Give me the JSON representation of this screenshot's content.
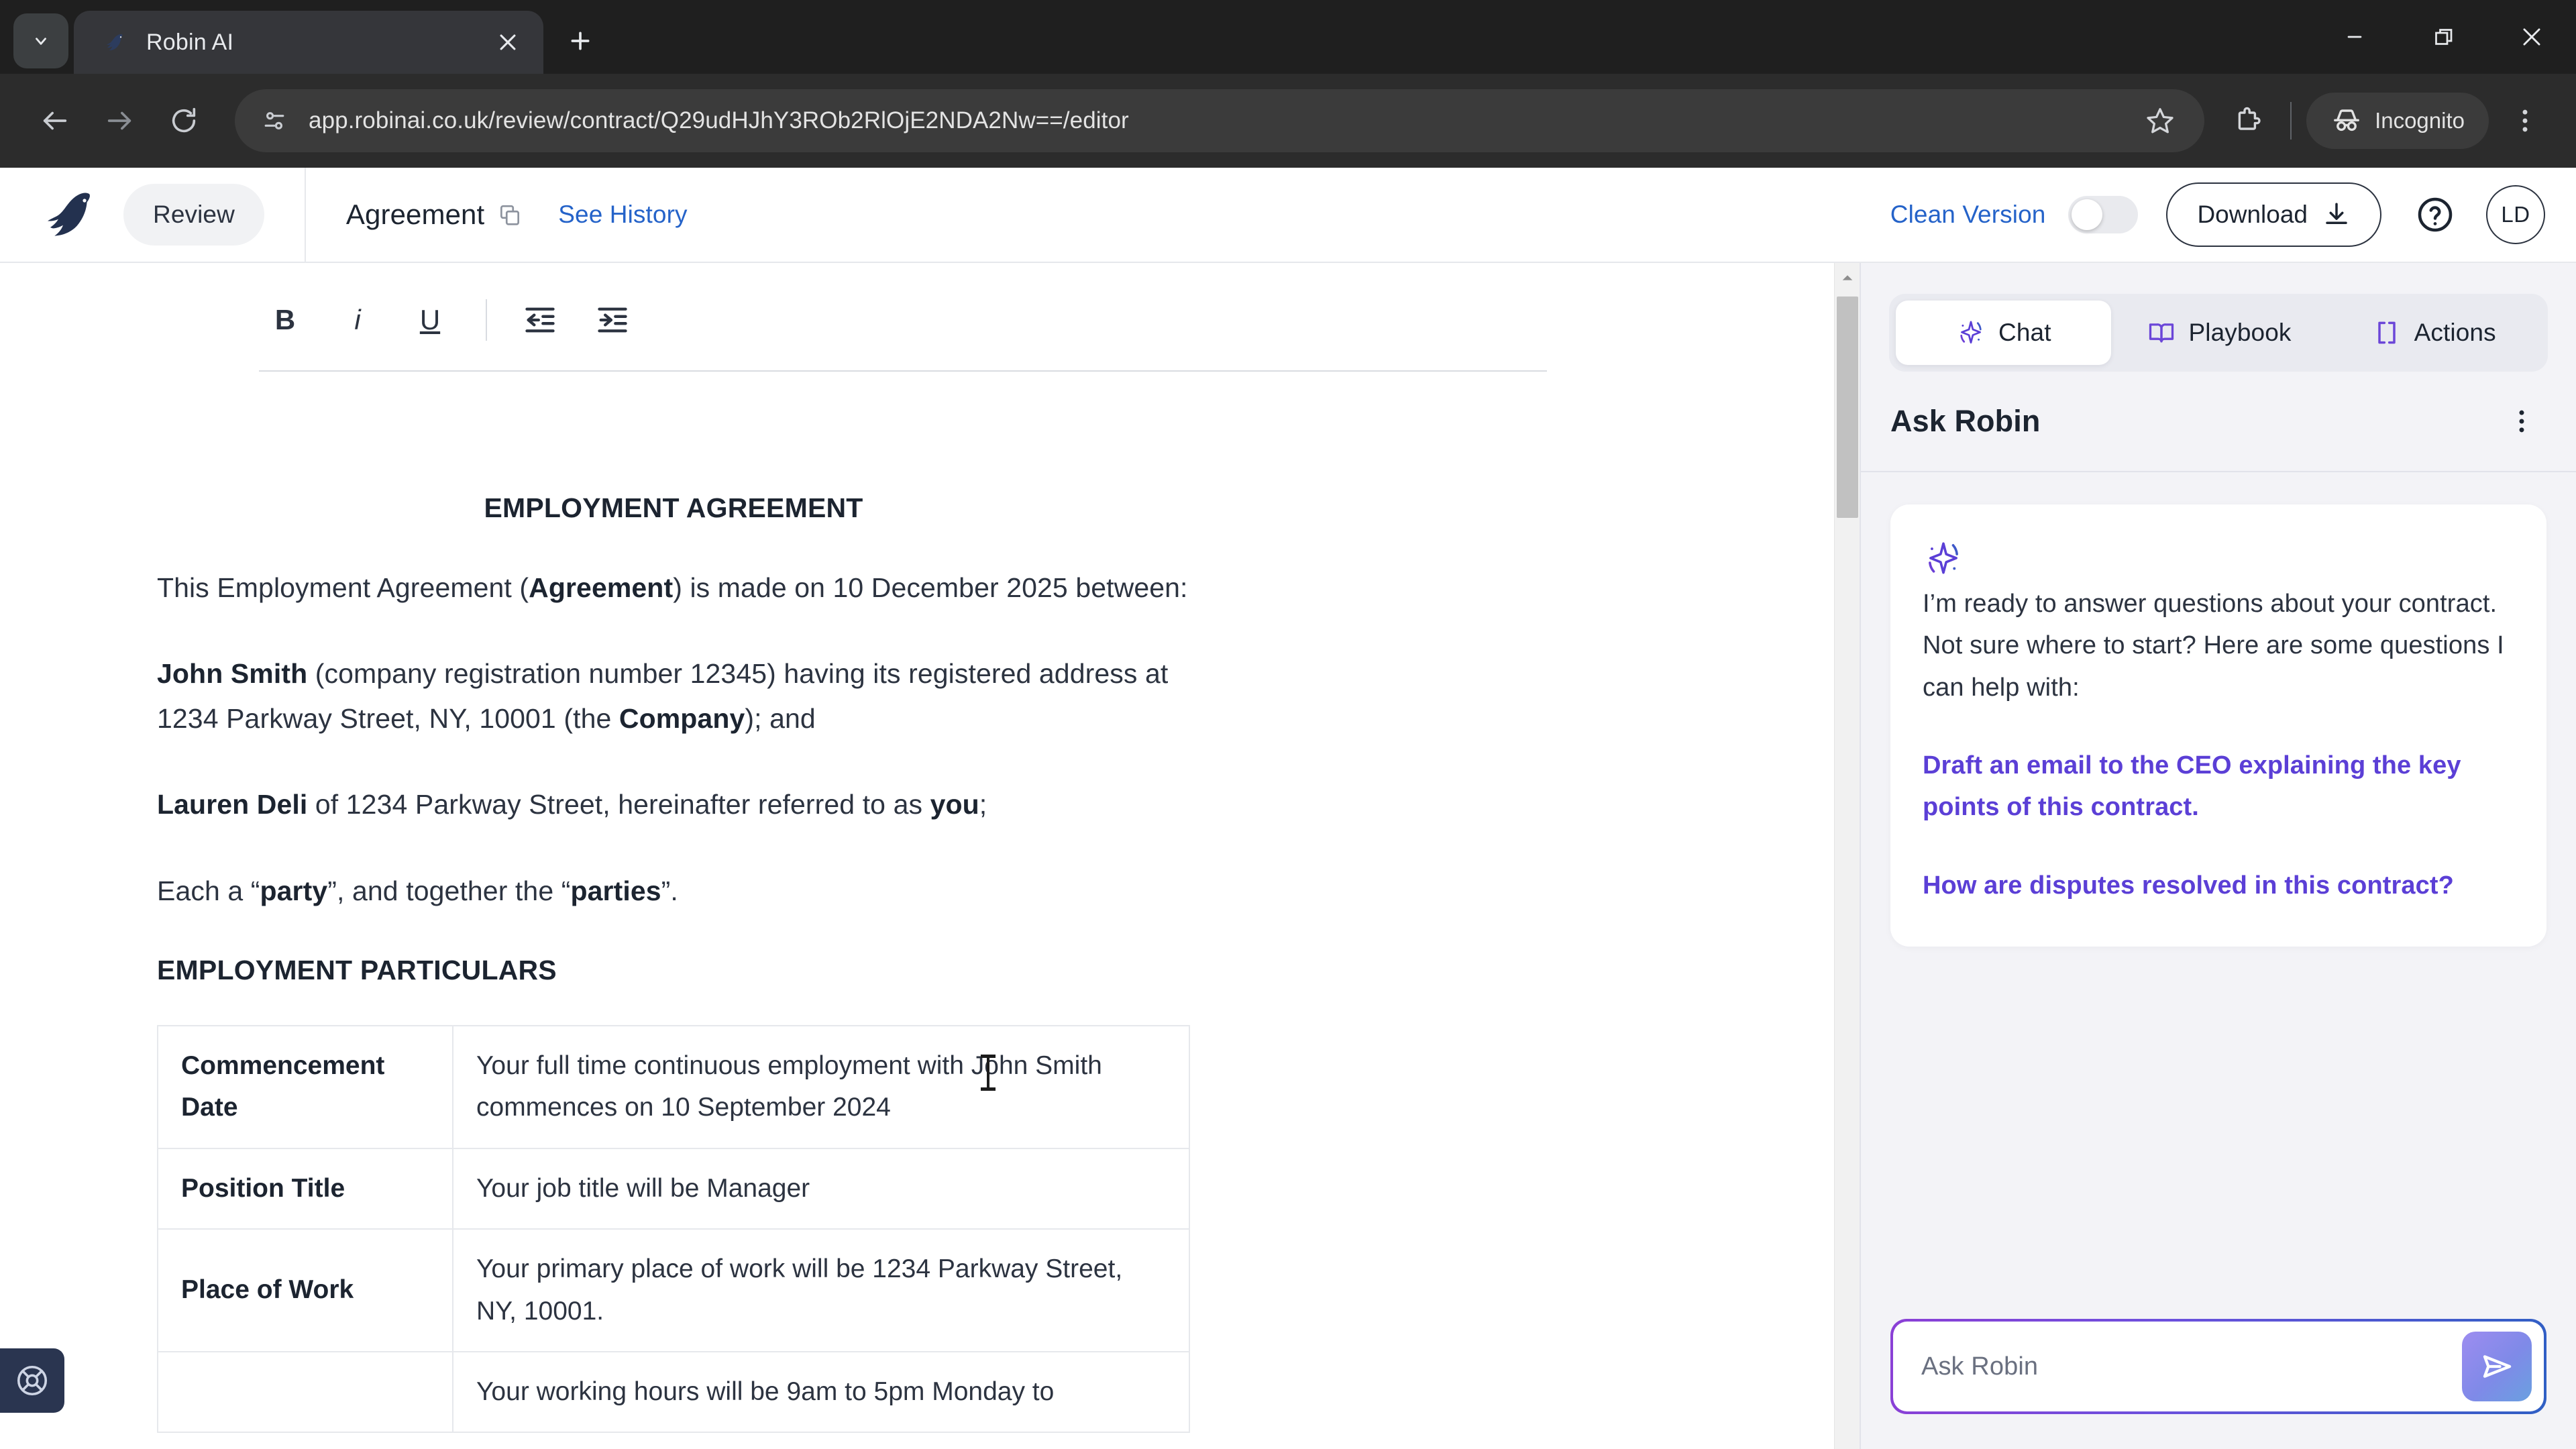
{
  "browser": {
    "tab": {
      "title": "Robin AI",
      "favicon_icon": "robin-bird-favicon",
      "close_icon": "close-icon"
    },
    "tab_list_icon": "chevron-down-icon",
    "new_tab_icon": "plus-icon",
    "window_controls": {
      "minimize_icon": "minimize-icon",
      "restore_icon": "restore-icon",
      "close_icon": "close-icon"
    },
    "nav": {
      "back_icon": "arrow-back-icon",
      "forward_icon": "arrow-forward-icon",
      "reload_icon": "reload-icon"
    },
    "omnibox": {
      "site_info_icon": "site-settings-icon",
      "url": "app.robinai.co.uk/review/contract/Q29udHJhY3ROb2RlOjE2NDA2Nw==/editor",
      "bookmark_icon": "star-icon"
    },
    "extensions_icon": "extensions-puzzle-icon",
    "incognito": {
      "label": "Incognito",
      "icon": "incognito-icon"
    },
    "menu_icon": "kebab-menu-icon"
  },
  "header": {
    "logo_icon": "robin-bird-logo",
    "review_label": "Review",
    "doc_title": "Agreement",
    "copy_icon": "copy-icon",
    "see_history_label": "See History",
    "clean_version_label": "Clean Version",
    "clean_version_enabled": false,
    "download_label": "Download",
    "download_icon": "download-icon",
    "help_icon": "help-circle-icon",
    "avatar_initials": "LD"
  },
  "editor_toolbar": {
    "bold": "B",
    "italic": "i",
    "underline": "U",
    "outdent_icon": "outdent-icon",
    "indent_icon": "indent-icon"
  },
  "document": {
    "heading": "EMPLOYMENT AGREEMENT",
    "intro_parts": {
      "a": "This Employment Agreement (",
      "b": "Agreement",
      "c": ") is made on 10 December 2025 between:"
    },
    "company_parts": {
      "a": "John Smith",
      "b": " (company registration number 12345) having its registered address at 1234 Parkway Street, NY, 10001 (the ",
      "c": "Company",
      "d": "); and"
    },
    "employee_parts": {
      "a": "Lauren Deli",
      "b": " of 1234 Parkway Street, hereinafter referred to as ",
      "c": "you",
      "d": ";"
    },
    "parties_parts": {
      "a": "Each a “",
      "b": "party",
      "c": "”, and together the “",
      "d": "parties",
      "e": "”."
    },
    "particulars_heading": "EMPLOYMENT PARTICULARS",
    "table_rows": [
      {
        "key": "Commencement Date",
        "value": "Your full time continuous employment with John Smith commences on 10 September 2024"
      },
      {
        "key": "Position Title",
        "value": "Your job title will be Manager"
      },
      {
        "key": "Place of Work",
        "value": "Your primary place of work will be 1234 Parkway Street, NY, 10001."
      },
      {
        "key": "",
        "value": "Your working hours will be 9am to 5pm Monday to"
      }
    ]
  },
  "chat": {
    "tabs": [
      {
        "label": "Chat",
        "icon": "sparkle-icon",
        "active": true
      },
      {
        "label": "Playbook",
        "icon": "book-icon",
        "active": false
      },
      {
        "label": "Actions",
        "icon": "brackets-icon",
        "active": false
      }
    ],
    "panel_title": "Ask Robin",
    "more_icon": "kebab-menu-icon",
    "assistant_icon": "sparkle-icon",
    "greeting_line1": "I’m ready to answer questions about your contract.",
    "greeting_line2": "Not sure where to start? Here are some questions I can help with:",
    "suggestions": [
      "Draft an email to the CEO explaining the key points of this contract.",
      "How are disputes resolved in this contract?"
    ],
    "input_placeholder": "Ask Robin",
    "send_icon": "send-icon"
  },
  "support": {
    "icon": "life-ring-icon"
  },
  "colors": {
    "link_blue": "#2563c9",
    "suggestion_purple": "#5b3fd6",
    "logo_navy": "#23314f",
    "panel_bg": "#f3f3f7"
  }
}
